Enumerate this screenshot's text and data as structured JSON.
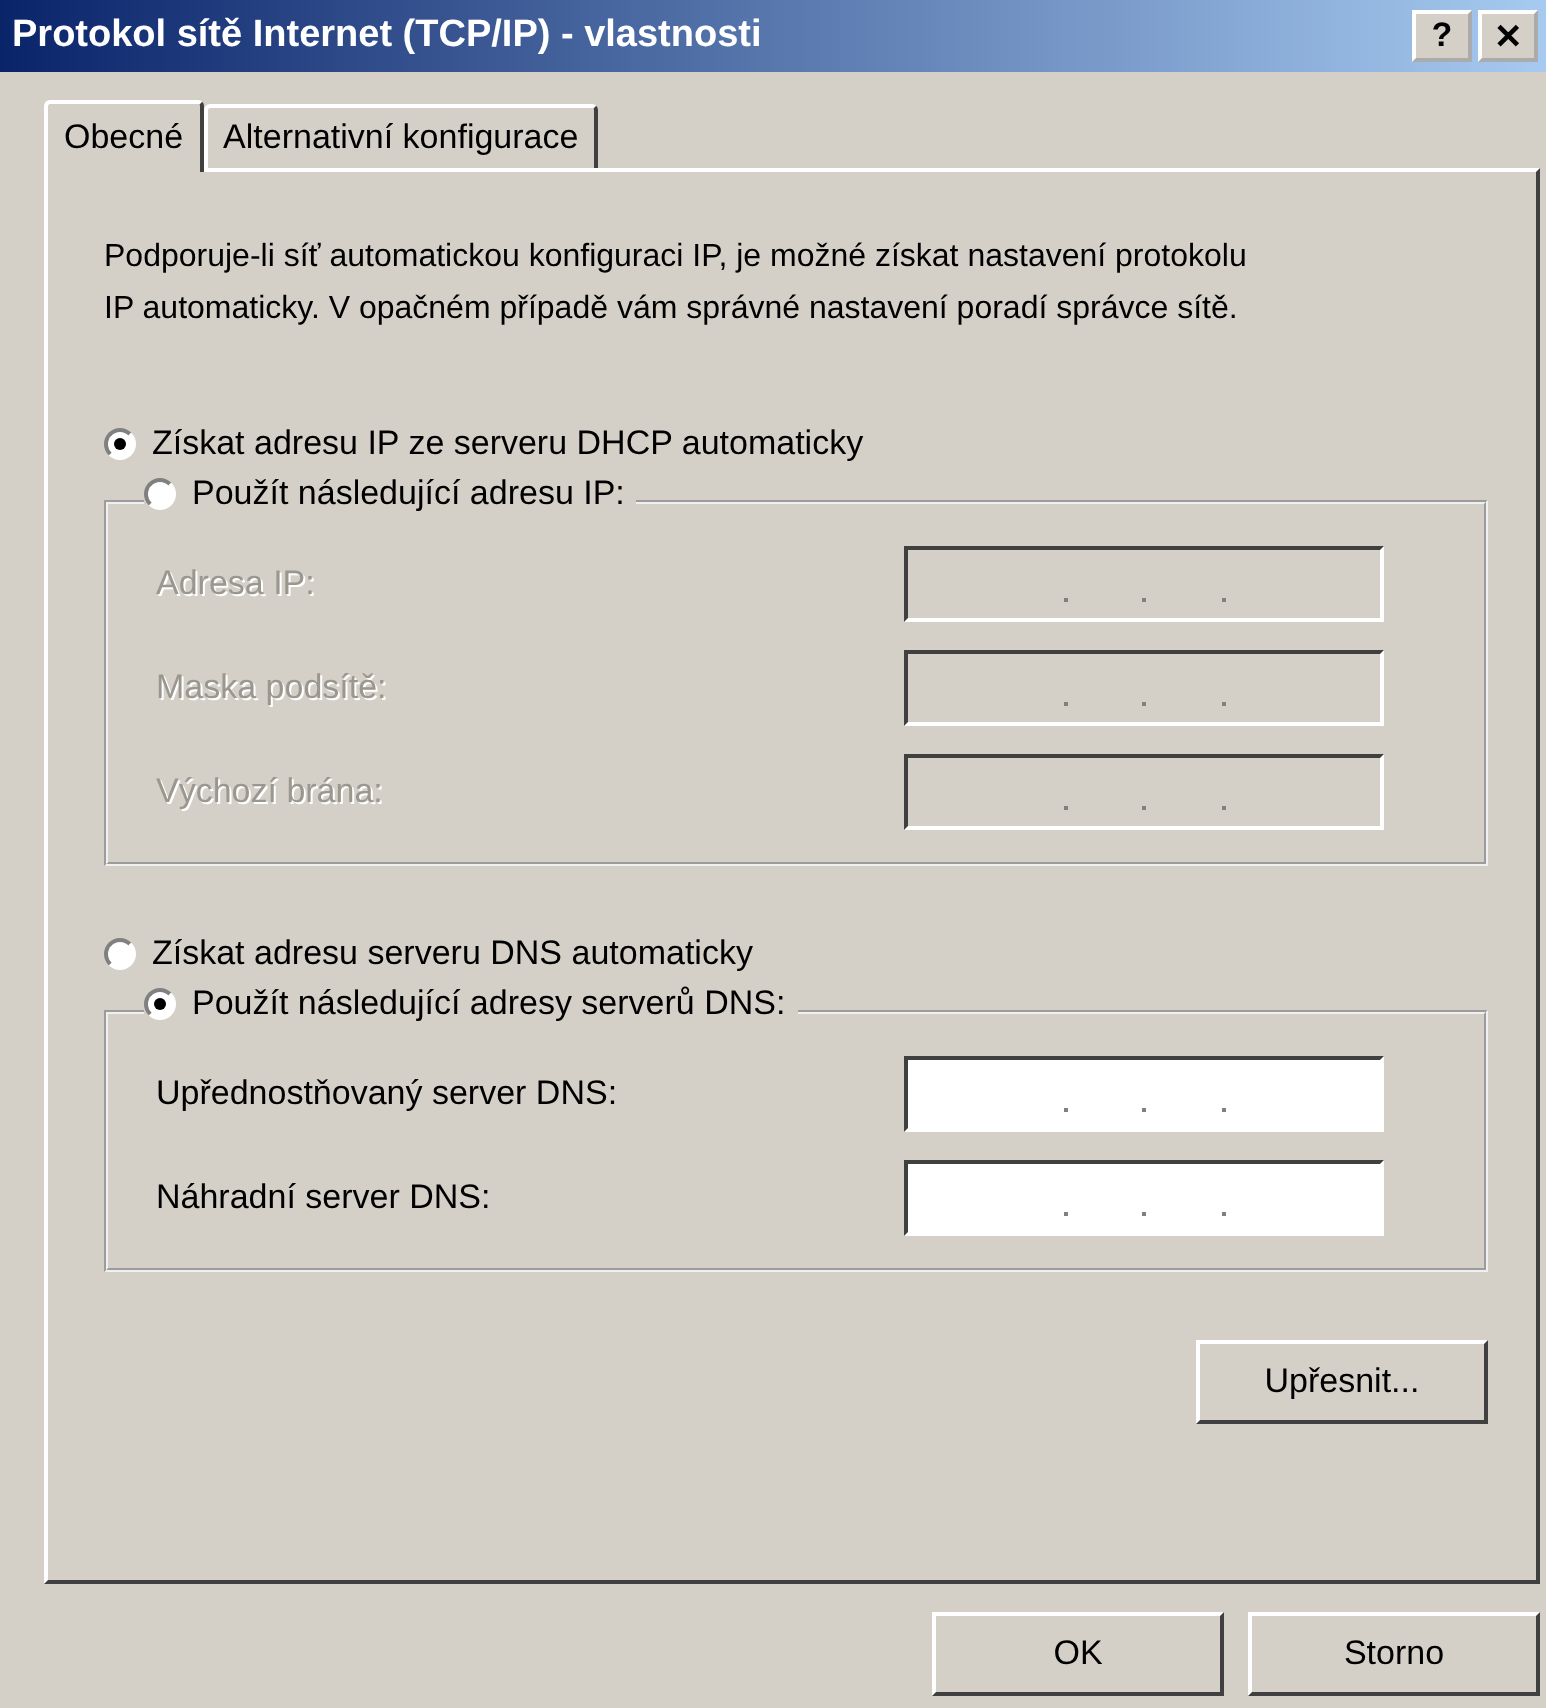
{
  "window": {
    "title": "Protokol sítě Internet (TCP/IP) - vlastnosti",
    "help": "?",
    "close": "✕"
  },
  "tabs": [
    {
      "label": "Obecné",
      "selected": true
    },
    {
      "label": "Alternativní konfigurace",
      "selected": false
    }
  ],
  "description": "Podporuje-li síť automatickou konfiguraci IP, je možné získat nastavení protokolu IP automaticky. V opačném případě vám správné nastavení poradí správce sítě.",
  "ip": {
    "auto": {
      "label": "Získat adresu IP ze serveru DHCP automaticky",
      "selected": true
    },
    "manual": {
      "label": "Použít následující adresu IP:",
      "selected": false,
      "disabled": true,
      "fields": [
        {
          "label": "Adresa IP:"
        },
        {
          "label": "Maska podsítě:"
        },
        {
          "label": "Výchozí brána:"
        }
      ]
    }
  },
  "dns": {
    "auto": {
      "label": "Získat adresu serveru DNS automaticky",
      "selected": false
    },
    "manual": {
      "label": "Použít následující adresy serverů DNS:",
      "selected": true,
      "disabled": false,
      "fields": [
        {
          "label": "Upřednostňovaný server DNS:"
        },
        {
          "label": "Náhradní server DNS:"
        }
      ]
    }
  },
  "advanced_button": "Upřesnit...",
  "buttons": [
    "OK",
    "Storno"
  ]
}
